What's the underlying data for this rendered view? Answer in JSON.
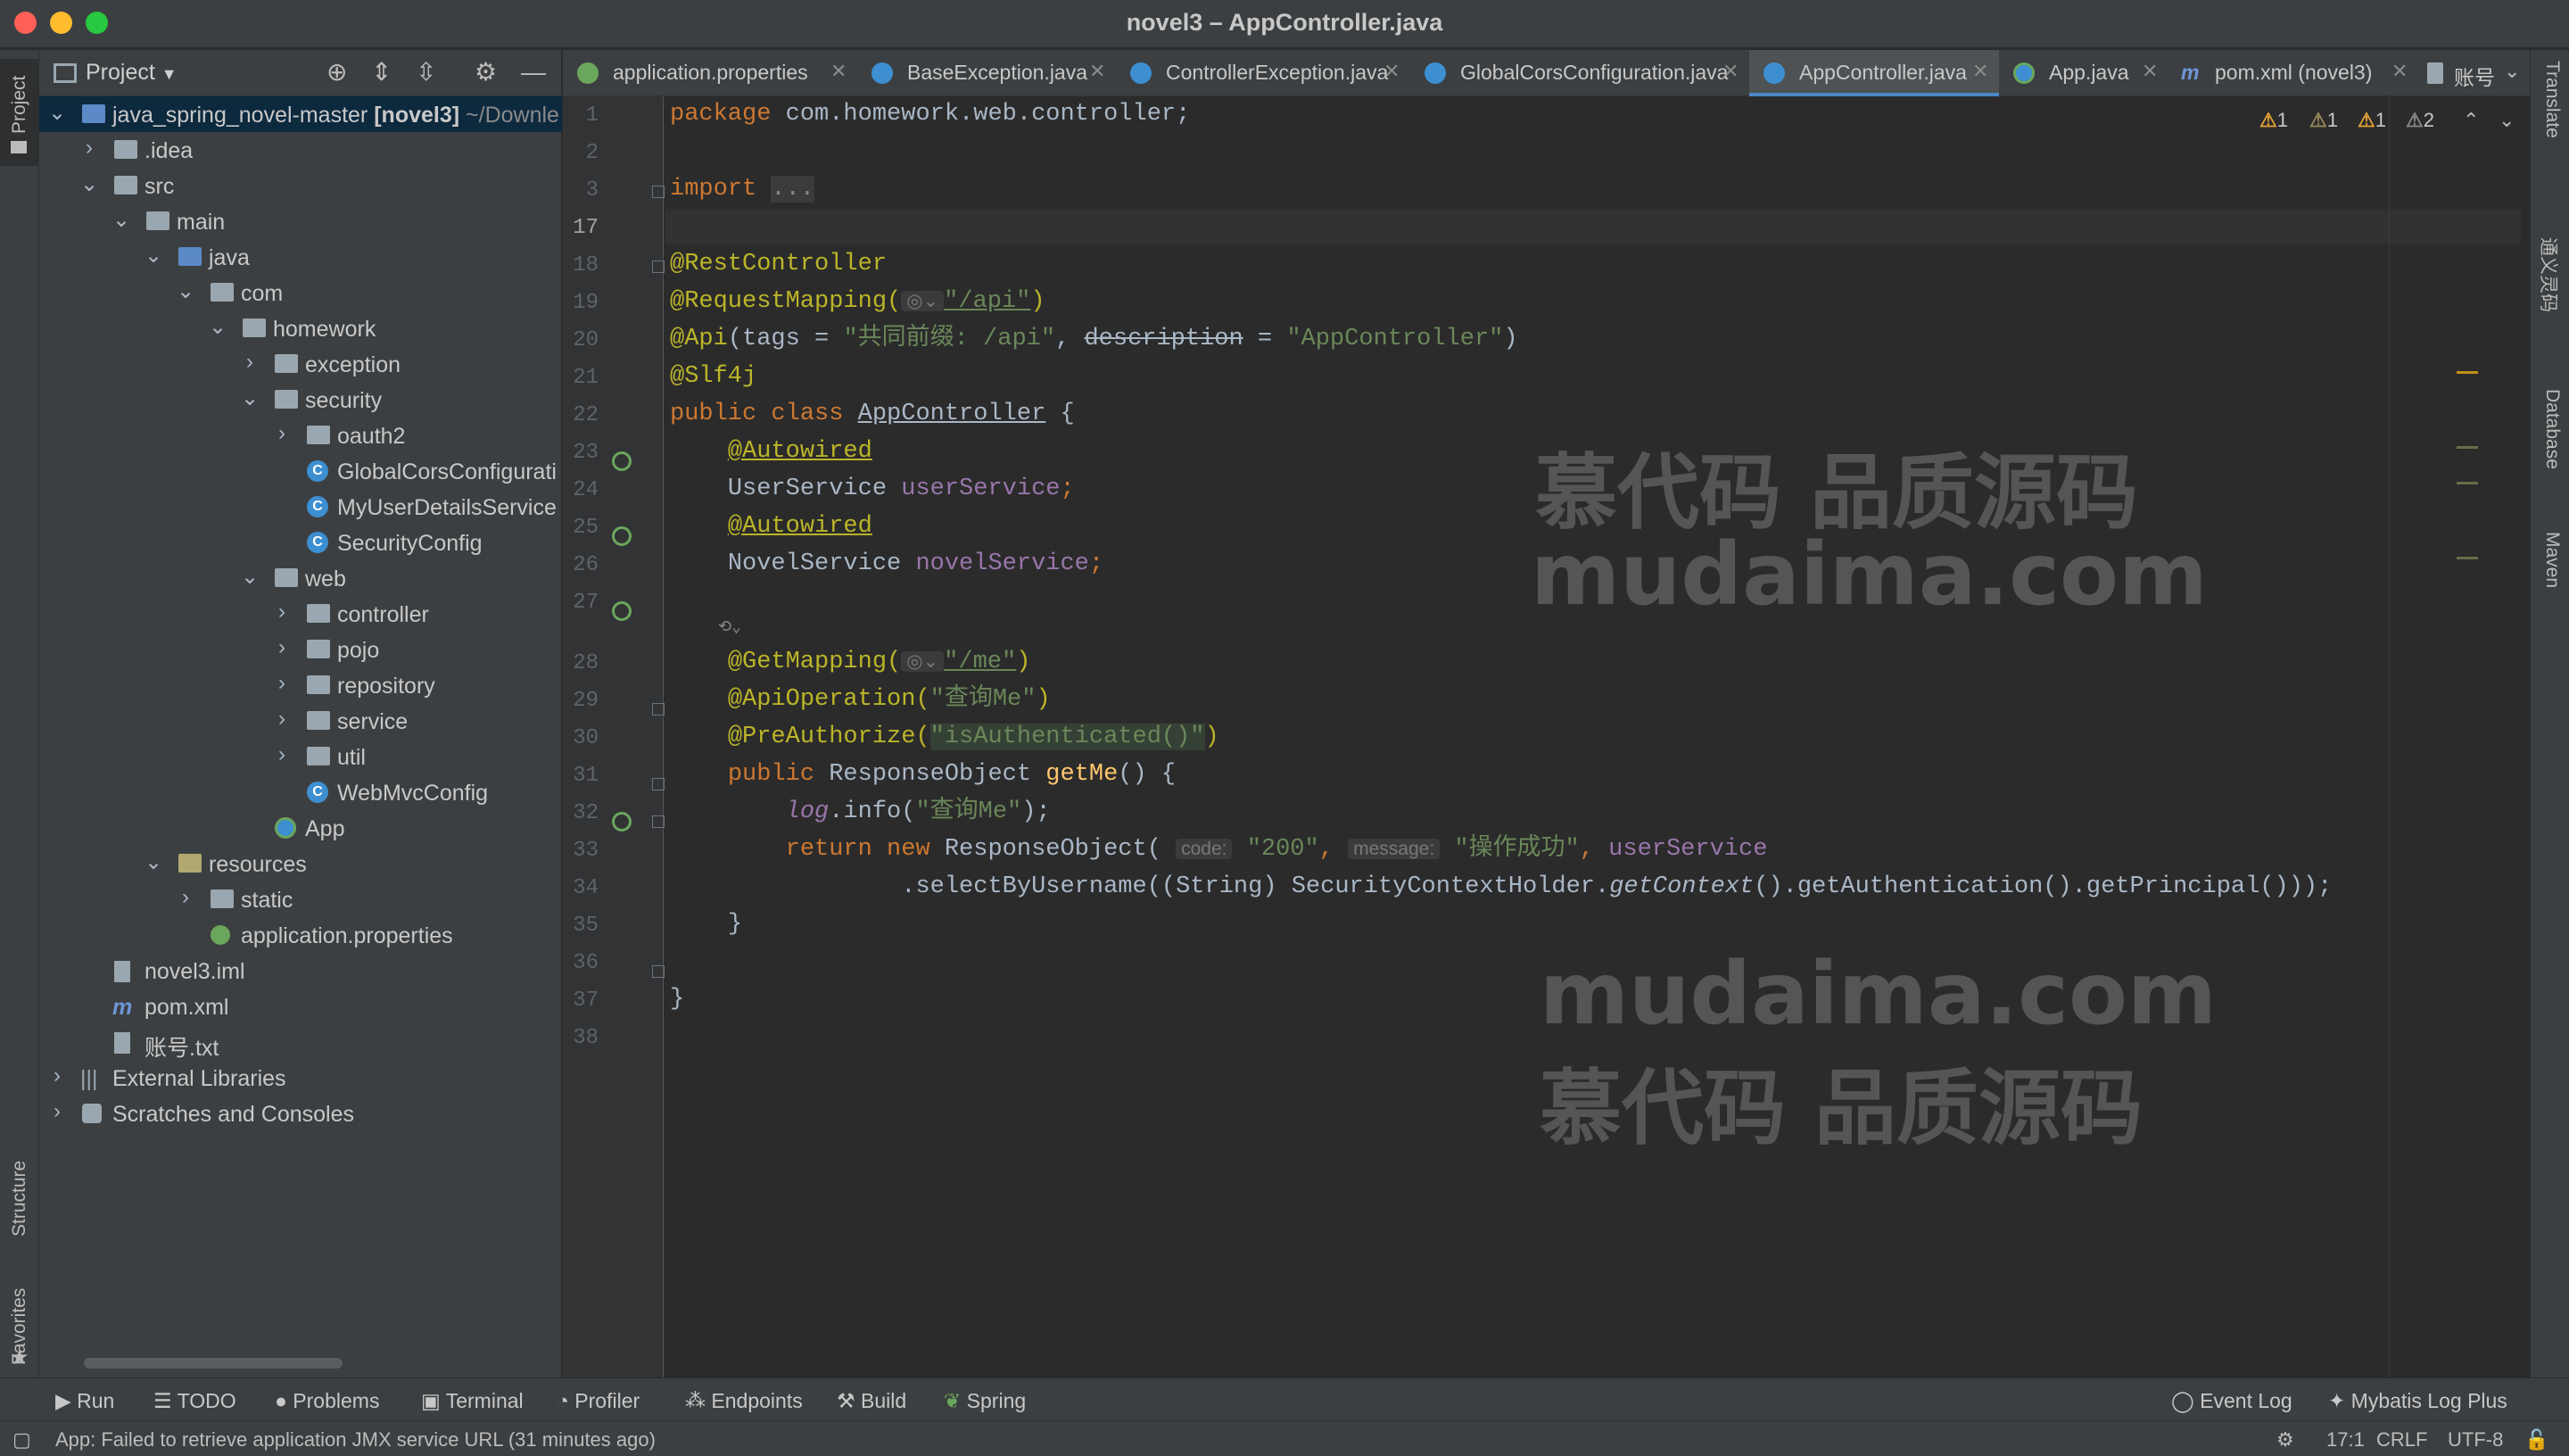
{
  "window": {
    "title": "novel3 – AppController.java"
  },
  "left_strip": {
    "project": "Project",
    "structure": "Structure",
    "favorites": "Favorites"
  },
  "project_panel": {
    "title": "Project",
    "tree": [
      {
        "label": "java_spring_novel-master",
        "bold": "[novel3]",
        "path": "~/Downle"
      },
      {
        "label": ".idea"
      },
      {
        "label": "src"
      },
      {
        "label": "main"
      },
      {
        "label": "java"
      },
      {
        "label": "com"
      },
      {
        "label": "homework"
      },
      {
        "label": "exception"
      },
      {
        "label": "security"
      },
      {
        "label": "oauth2"
      },
      {
        "label": "GlobalCorsConfigurati"
      },
      {
        "label": "MyUserDetailsService"
      },
      {
        "label": "SecurityConfig"
      },
      {
        "label": "web"
      },
      {
        "label": "controller"
      },
      {
        "label": "pojo"
      },
      {
        "label": "repository"
      },
      {
        "label": "service"
      },
      {
        "label": "util"
      },
      {
        "label": "WebMvcConfig"
      },
      {
        "label": "App"
      },
      {
        "label": "resources"
      },
      {
        "label": "static"
      },
      {
        "label": "application.properties"
      },
      {
        "label": "novel3.iml"
      },
      {
        "label": "pom.xml"
      },
      {
        "label": "账号.txt"
      },
      {
        "label": "External Libraries"
      },
      {
        "label": "Scratches and Consoles"
      }
    ]
  },
  "tabs": [
    {
      "label": "application.properties"
    },
    {
      "label": "BaseException.java"
    },
    {
      "label": "ControllerException.java"
    },
    {
      "label": "GlobalCorsConfiguration.java"
    },
    {
      "label": "AppController.java"
    },
    {
      "label": "App.java"
    },
    {
      "label": "pom.xml (novel3)"
    },
    {
      "label": "账号"
    }
  ],
  "gutter": {
    "lines": [
      "1",
      "2",
      "3",
      "17",
      "18",
      "19",
      "20",
      "21",
      "22",
      "23",
      "24",
      "25",
      "26",
      "27",
      "28",
      "29",
      "30",
      "31",
      "32",
      "33",
      "34",
      "35",
      "36",
      "37",
      "38"
    ]
  },
  "inspections": {
    "w1": "1",
    "w2": "1",
    "w3": "1",
    "w4": "2"
  },
  "code": {
    "l1_kw": "package",
    "l1_rest": " com.homework.web.controller;",
    "l3_kw": "import",
    "l3_rest": "...",
    "l18": "@RestController",
    "l19_an": "@RequestMapping(",
    "l19_str": "\"/api\"",
    "l19_end": ")",
    "l20_an": "@Api",
    "l20_a": "(tags = ",
    "l20_s1": "\"共同前缀: /api\"",
    "l20_b": ", ",
    "l20_desc": "description",
    "l20_c": " = ",
    "l20_s2": "\"AppController\"",
    "l20_d": ")",
    "l21": "@Slf4j",
    "l22_kw": "public class ",
    "l22_name": "AppController",
    "l22_rest": " {",
    "l23": "@Autowired",
    "l24_t": "UserService ",
    "l24_f": "userService",
    "l24_e": ";",
    "l25": "@Autowired",
    "l26_t": "NovelService ",
    "l26_f": "novelService",
    "l26_e": ";",
    "l28_an": "@GetMapping(",
    "l28_str": "\"/me\"",
    "l28_end": ")",
    "l29_an": "@ApiOperation(",
    "l29_str": "\"查询Me\"",
    "l29_end": ")",
    "l30_an": "@PreAuthorize(",
    "l30_str": "\"isAuthenticated()\"",
    "l30_end": ")",
    "l31_kw": "public ",
    "l31_t": "ResponseObject ",
    "l31_fn": "getMe",
    "l31_e": "() {",
    "l32_log": "log",
    "l32_a": ".info(",
    "l32_str": "\"查询Me\"",
    "l32_e": ");",
    "l33_kw": "return new ",
    "l33_t": "ResponseObject(",
    "l33_h1": "code:",
    "l33_s1": "\"200\"",
    "l33_c": ", ",
    "l33_h2": "message:",
    "l33_s2": "\"操作成功\"",
    "l33_c2": ", ",
    "l33_f": "userService",
    "l34_a": ".selectByUsername((String) SecurityContextHolder.",
    "l34_it": "getContext",
    "l34_b": "().getAuthentication().getPrincipal()));",
    "l35": "}",
    "l37": "}"
  },
  "watermark": {
    "cn": "慕代码 品质源码",
    "en": "mudaima.com"
  },
  "right_strip": {
    "translate": "Translate",
    "tongyi": "通义灵码",
    "database": "Database",
    "maven": "Maven"
  },
  "bottom_bar": {
    "run": "Run",
    "todo": "TODO",
    "problems": "Problems",
    "terminal": "Terminal",
    "profiler": "Profiler",
    "endpoints": "Endpoints",
    "build": "Build",
    "spring": "Spring",
    "event_log": "Event Log",
    "mybatis": "Mybatis Log Plus"
  },
  "status": {
    "message": "App: Failed to retrieve application JMX service URL (31 minutes ago)",
    "position": "17:1",
    "line_sep": "CRLF",
    "encoding": "UTF-8"
  },
  "colors": {
    "accent": "#4a88c7",
    "keyword": "#cc7832",
    "annotation": "#bbb529",
    "string": "#6a8759",
    "warning": "#e5a235"
  }
}
